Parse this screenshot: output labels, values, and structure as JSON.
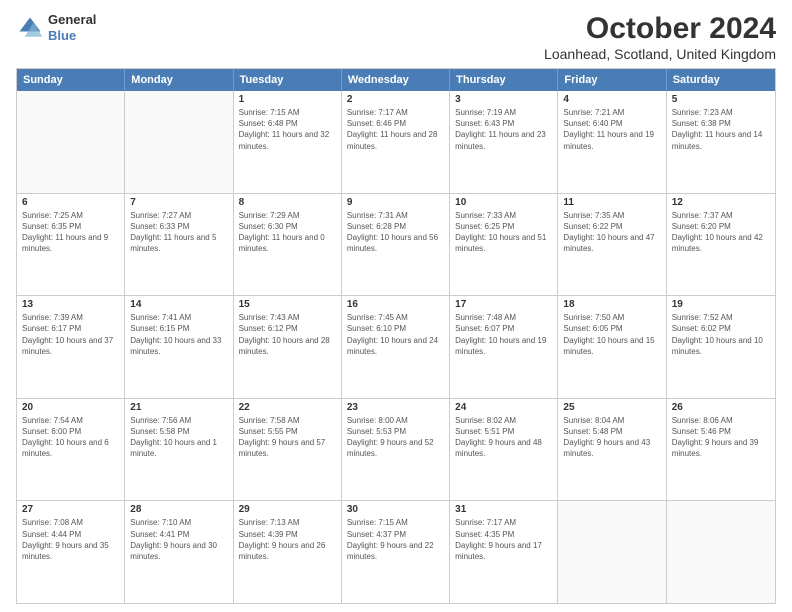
{
  "header": {
    "logo": {
      "line1": "General",
      "line2": "Blue"
    },
    "title": "October 2024",
    "subtitle": "Loanhead, Scotland, United Kingdom"
  },
  "calendar": {
    "headers": [
      "Sunday",
      "Monday",
      "Tuesday",
      "Wednesday",
      "Thursday",
      "Friday",
      "Saturday"
    ],
    "rows": [
      [
        {
          "date": "",
          "sunrise": "",
          "sunset": "",
          "daylight": ""
        },
        {
          "date": "",
          "sunrise": "",
          "sunset": "",
          "daylight": ""
        },
        {
          "date": "1",
          "sunrise": "Sunrise: 7:15 AM",
          "sunset": "Sunset: 6:48 PM",
          "daylight": "Daylight: 11 hours and 32 minutes."
        },
        {
          "date": "2",
          "sunrise": "Sunrise: 7:17 AM",
          "sunset": "Sunset: 6:46 PM",
          "daylight": "Daylight: 11 hours and 28 minutes."
        },
        {
          "date": "3",
          "sunrise": "Sunrise: 7:19 AM",
          "sunset": "Sunset: 6:43 PM",
          "daylight": "Daylight: 11 hours and 23 minutes."
        },
        {
          "date": "4",
          "sunrise": "Sunrise: 7:21 AM",
          "sunset": "Sunset: 6:40 PM",
          "daylight": "Daylight: 11 hours and 19 minutes."
        },
        {
          "date": "5",
          "sunrise": "Sunrise: 7:23 AM",
          "sunset": "Sunset: 6:38 PM",
          "daylight": "Daylight: 11 hours and 14 minutes."
        }
      ],
      [
        {
          "date": "6",
          "sunrise": "Sunrise: 7:25 AM",
          "sunset": "Sunset: 6:35 PM",
          "daylight": "Daylight: 11 hours and 9 minutes."
        },
        {
          "date": "7",
          "sunrise": "Sunrise: 7:27 AM",
          "sunset": "Sunset: 6:33 PM",
          "daylight": "Daylight: 11 hours and 5 minutes."
        },
        {
          "date": "8",
          "sunrise": "Sunrise: 7:29 AM",
          "sunset": "Sunset: 6:30 PM",
          "daylight": "Daylight: 11 hours and 0 minutes."
        },
        {
          "date": "9",
          "sunrise": "Sunrise: 7:31 AM",
          "sunset": "Sunset: 6:28 PM",
          "daylight": "Daylight: 10 hours and 56 minutes."
        },
        {
          "date": "10",
          "sunrise": "Sunrise: 7:33 AM",
          "sunset": "Sunset: 6:25 PM",
          "daylight": "Daylight: 10 hours and 51 minutes."
        },
        {
          "date": "11",
          "sunrise": "Sunrise: 7:35 AM",
          "sunset": "Sunset: 6:22 PM",
          "daylight": "Daylight: 10 hours and 47 minutes."
        },
        {
          "date": "12",
          "sunrise": "Sunrise: 7:37 AM",
          "sunset": "Sunset: 6:20 PM",
          "daylight": "Daylight: 10 hours and 42 minutes."
        }
      ],
      [
        {
          "date": "13",
          "sunrise": "Sunrise: 7:39 AM",
          "sunset": "Sunset: 6:17 PM",
          "daylight": "Daylight: 10 hours and 37 minutes."
        },
        {
          "date": "14",
          "sunrise": "Sunrise: 7:41 AM",
          "sunset": "Sunset: 6:15 PM",
          "daylight": "Daylight: 10 hours and 33 minutes."
        },
        {
          "date": "15",
          "sunrise": "Sunrise: 7:43 AM",
          "sunset": "Sunset: 6:12 PM",
          "daylight": "Daylight: 10 hours and 28 minutes."
        },
        {
          "date": "16",
          "sunrise": "Sunrise: 7:45 AM",
          "sunset": "Sunset: 6:10 PM",
          "daylight": "Daylight: 10 hours and 24 minutes."
        },
        {
          "date": "17",
          "sunrise": "Sunrise: 7:48 AM",
          "sunset": "Sunset: 6:07 PM",
          "daylight": "Daylight: 10 hours and 19 minutes."
        },
        {
          "date": "18",
          "sunrise": "Sunrise: 7:50 AM",
          "sunset": "Sunset: 6:05 PM",
          "daylight": "Daylight: 10 hours and 15 minutes."
        },
        {
          "date": "19",
          "sunrise": "Sunrise: 7:52 AM",
          "sunset": "Sunset: 6:02 PM",
          "daylight": "Daylight: 10 hours and 10 minutes."
        }
      ],
      [
        {
          "date": "20",
          "sunrise": "Sunrise: 7:54 AM",
          "sunset": "Sunset: 6:00 PM",
          "daylight": "Daylight: 10 hours and 6 minutes."
        },
        {
          "date": "21",
          "sunrise": "Sunrise: 7:56 AM",
          "sunset": "Sunset: 5:58 PM",
          "daylight": "Daylight: 10 hours and 1 minute."
        },
        {
          "date": "22",
          "sunrise": "Sunrise: 7:58 AM",
          "sunset": "Sunset: 5:55 PM",
          "daylight": "Daylight: 9 hours and 57 minutes."
        },
        {
          "date": "23",
          "sunrise": "Sunrise: 8:00 AM",
          "sunset": "Sunset: 5:53 PM",
          "daylight": "Daylight: 9 hours and 52 minutes."
        },
        {
          "date": "24",
          "sunrise": "Sunrise: 8:02 AM",
          "sunset": "Sunset: 5:51 PM",
          "daylight": "Daylight: 9 hours and 48 minutes."
        },
        {
          "date": "25",
          "sunrise": "Sunrise: 8:04 AM",
          "sunset": "Sunset: 5:48 PM",
          "daylight": "Daylight: 9 hours and 43 minutes."
        },
        {
          "date": "26",
          "sunrise": "Sunrise: 8:06 AM",
          "sunset": "Sunset: 5:46 PM",
          "daylight": "Daylight: 9 hours and 39 minutes."
        }
      ],
      [
        {
          "date": "27",
          "sunrise": "Sunrise: 7:08 AM",
          "sunset": "Sunset: 4:44 PM",
          "daylight": "Daylight: 9 hours and 35 minutes."
        },
        {
          "date": "28",
          "sunrise": "Sunrise: 7:10 AM",
          "sunset": "Sunset: 4:41 PM",
          "daylight": "Daylight: 9 hours and 30 minutes."
        },
        {
          "date": "29",
          "sunrise": "Sunrise: 7:13 AM",
          "sunset": "Sunset: 4:39 PM",
          "daylight": "Daylight: 9 hours and 26 minutes."
        },
        {
          "date": "30",
          "sunrise": "Sunrise: 7:15 AM",
          "sunset": "Sunset: 4:37 PM",
          "daylight": "Daylight: 9 hours and 22 minutes."
        },
        {
          "date": "31",
          "sunrise": "Sunrise: 7:17 AM",
          "sunset": "Sunset: 4:35 PM",
          "daylight": "Daylight: 9 hours and 17 minutes."
        },
        {
          "date": "",
          "sunrise": "",
          "sunset": "",
          "daylight": ""
        },
        {
          "date": "",
          "sunrise": "",
          "sunset": "",
          "daylight": ""
        }
      ]
    ]
  }
}
